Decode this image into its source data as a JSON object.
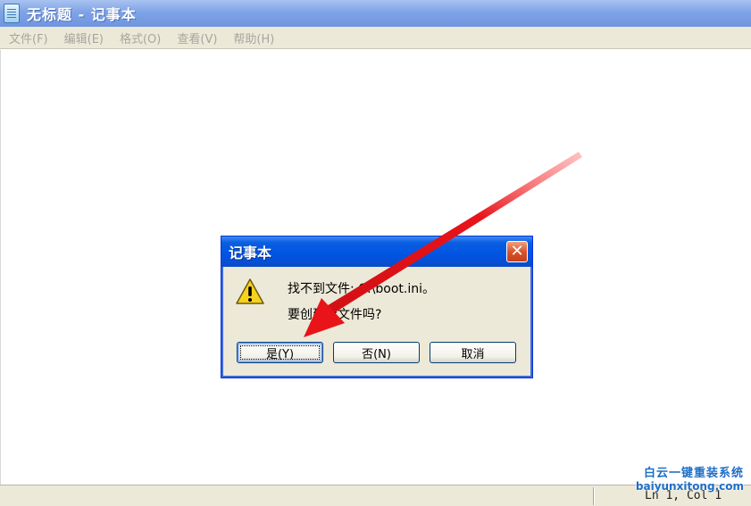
{
  "window": {
    "title": "无标题 - 记事本"
  },
  "menu": {
    "items": [
      "文件(F)",
      "编辑(E)",
      "格式(O)",
      "查看(V)",
      "帮助(H)"
    ]
  },
  "statusbar": {
    "position": "Ln 1, Col 1"
  },
  "dialog": {
    "title": "记事本",
    "line1": "找不到文件: C:\\boot.ini。",
    "line2": "要创建新文件吗?",
    "buttons": {
      "yes": "是(Y)",
      "no": "否(N)",
      "cancel": "取消"
    },
    "icon": "warning-icon"
  },
  "annotation": {
    "arrow_color": "#e8141a"
  },
  "watermark": {
    "logo": "白云一键重装系统",
    "url": "baiyunxitong.com"
  },
  "colors": {
    "title_bar": "#7fa3e6",
    "dialog_title": "#0054e3",
    "menu_bg": "#ece9d8",
    "close_red": "#d9532c"
  }
}
